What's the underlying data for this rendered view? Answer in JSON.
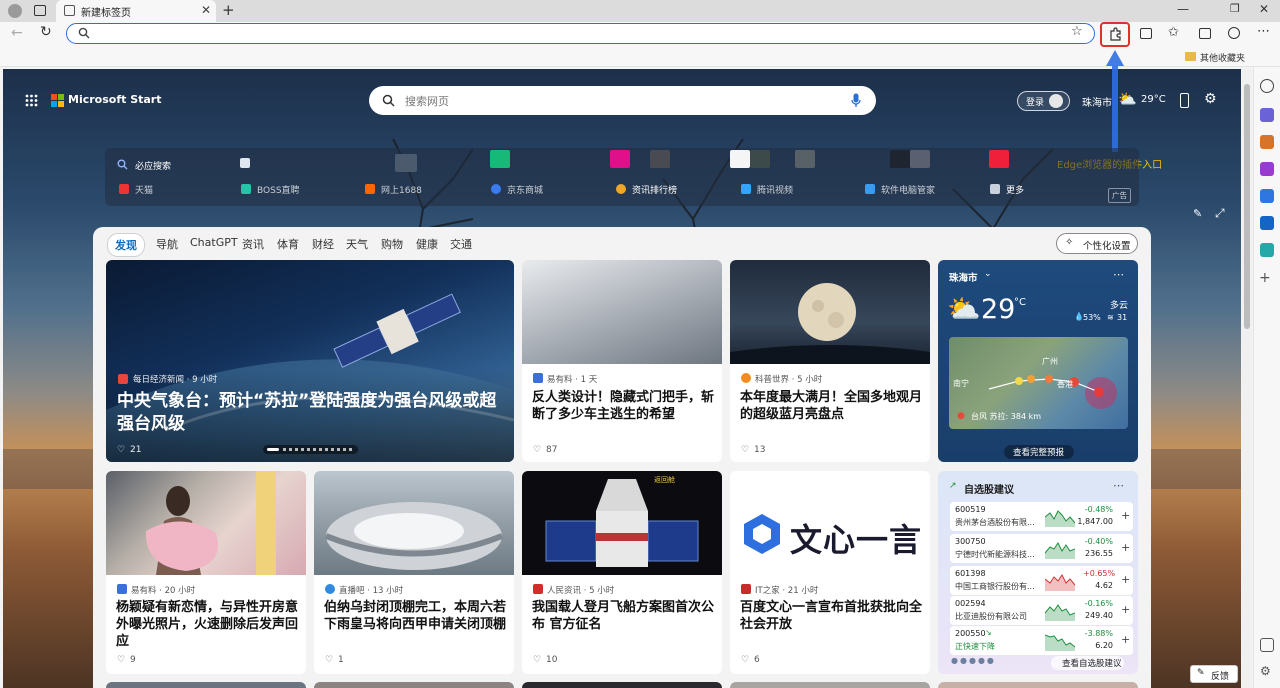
{
  "browser": {
    "tab_title": "新建标签页",
    "new_tab": "+"
  },
  "favorites": {
    "other": "其他收藏夹"
  },
  "annotation": {
    "text": "Edge浏览器的插件入口",
    "color": "#f7c400",
    "box_color": "#e03030",
    "arrow_color": "#2f6fe0"
  },
  "header": {
    "brand": "Microsoft Start",
    "search_placeholder": "搜索网页",
    "login": "登录",
    "location": "珠海市",
    "temperature": "29°C"
  },
  "quick_links": {
    "row1": [
      "必应搜索"
    ],
    "row2": [
      "天猫",
      "BOSS直聘",
      "网上1688",
      "京东商城",
      "资讯排行榜",
      "腾讯视频",
      "软件电脑管家",
      "更多"
    ],
    "ad": "广告"
  },
  "nav": {
    "tabs": [
      "发现",
      "导航",
      "ChatGPT",
      "资讯",
      "体育",
      "财经",
      "天气",
      "购物",
      "健康",
      "交通"
    ],
    "active": "发现",
    "personalize": "个性化设置"
  },
  "hero": {
    "source": "每日经济新闻 · 9 小时",
    "title": "中央气象台：预计“苏拉”登陆强度为强台风级或超强台风级",
    "likes": "21"
  },
  "cards": [
    {
      "source": "易有料 · 1 天",
      "title": "反人类设计！隐藏式门把手，斩断了多少车主逃生的希望",
      "likes": "87"
    },
    {
      "source": "科普世界 · 5 小时",
      "title": "本年度最大满月！全国多地观月的超级蓝月亮盘点",
      "likes": "13"
    },
    {
      "source": "易有料 · 20 小时",
      "title": "杨颖疑有新恋情，与异性开房意外曝光照片，火速删除后发声回应",
      "likes": "9"
    },
    {
      "source": "直播吧 · 13 小时",
      "title": "伯纳乌封闭顶棚完工，本周六若下雨皇马将向西甲申请关闭顶棚",
      "likes": "1"
    },
    {
      "source": "人民资讯 · 5 小时",
      "title": "我国载人登月飞船方案图首次公布 官方征名",
      "likes": "10",
      "img_label": "返回舱"
    },
    {
      "source": "IT之家 · 21 小时",
      "title": "百度文心一言宣布首批获批向全社会开放",
      "likes": "6",
      "img_label": "文心一言"
    }
  ],
  "weather": {
    "city": "珠海市",
    "temp": "29",
    "unit": "°C",
    "cond": "多云",
    "humidity": "53%",
    "wind": "31",
    "map_labels": [
      "广州",
      "香港",
      "南宁"
    ],
    "typhoon": "台风 苏拉: 384 km",
    "more": "查看完整预报"
  },
  "stocks": {
    "title": "自选股建议",
    "items": [
      {
        "code": "600519",
        "name": "贵州茅台酒股份有限...",
        "change": "-0.48%",
        "price": "1,847.00",
        "up": false
      },
      {
        "code": "300750",
        "name": "宁德时代新能源科技...",
        "change": "-0.40%",
        "price": "236.55",
        "up": false
      },
      {
        "code": "601398",
        "name": "中国工商银行股份有...",
        "change": "+0.65%",
        "price": "4.62",
        "up": true
      },
      {
        "code": "002594",
        "name": "比亚迪股份有限公司",
        "change": "-0.16%",
        "price": "249.40",
        "up": false
      },
      {
        "code": "200550",
        "name": "正快速下降",
        "change": "-3.88%",
        "price": "6.20",
        "up": false
      }
    ],
    "more": "查看自选股建议"
  },
  "feedback": "反馈"
}
